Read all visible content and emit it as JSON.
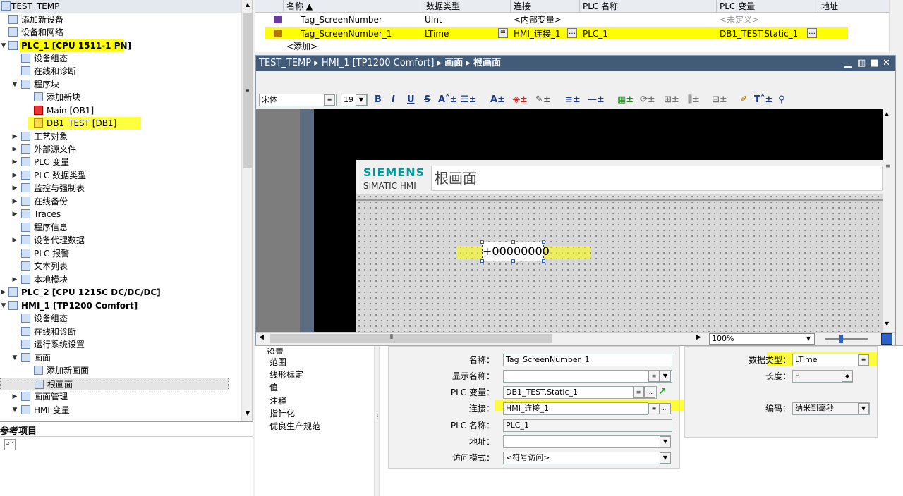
{
  "tree": {
    "project": "TEST_TEMP",
    "items": [
      {
        "label": "添加新设备",
        "level": 1
      },
      {
        "label": "设备和网络",
        "level": 1
      },
      {
        "label": "PLC_1 [CPU 1511-1 PN]",
        "level": 0
      },
      {
        "label": "设备组态",
        "level": 2
      },
      {
        "label": "在线和诊断",
        "level": 2
      },
      {
        "label": "程序块",
        "level": 2
      },
      {
        "label": "添加新块",
        "level": 3
      },
      {
        "label": "Main [OB1]",
        "level": 3
      },
      {
        "label": "DB1_TEST [DB1]",
        "level": 3
      },
      {
        "label": "工艺对象",
        "level": 2
      },
      {
        "label": "外部源文件",
        "level": 2
      },
      {
        "label": "PLC 变量",
        "level": 2
      },
      {
        "label": "PLC 数据类型",
        "level": 2
      },
      {
        "label": "监控与强制表",
        "level": 2
      },
      {
        "label": "在线备份",
        "level": 2
      },
      {
        "label": "Traces",
        "level": 2
      },
      {
        "label": "程序信息",
        "level": 2
      },
      {
        "label": "设备代理数据",
        "level": 2
      },
      {
        "label": "PLC 报警",
        "level": 2
      },
      {
        "label": "文本列表",
        "level": 2
      },
      {
        "label": "本地模块",
        "level": 2
      },
      {
        "label": "PLC_2 [CPU 1215C DC/DC/DC]",
        "level": 0
      },
      {
        "label": "HMI_1 [TP1200 Comfort]",
        "level": 0
      },
      {
        "label": "设备组态",
        "level": 2
      },
      {
        "label": "在线和诊断",
        "level": 2
      },
      {
        "label": "运行系统设置",
        "level": 2
      },
      {
        "label": "画面",
        "level": 2
      },
      {
        "label": "添加新画面",
        "level": 3
      },
      {
        "label": "根画面",
        "level": 3
      },
      {
        "label": "画面管理",
        "level": 2
      },
      {
        "label": "HMI 变量",
        "level": 2
      }
    ]
  },
  "reference": {
    "title": "参考项目"
  },
  "grid": {
    "headers": [
      "名称",
      "数据类型",
      "连接",
      "PLC 名称",
      "PLC 变量",
      "地址"
    ],
    "rows": [
      {
        "name": "Tag_ScreenNumber",
        "type": "UInt",
        "conn": "<内部变量>",
        "plc": "",
        "var": "<未定义>"
      },
      {
        "name": "Tag_ScreenNumber_1",
        "type": "LTime",
        "conn": "HMI_连接_1",
        "plc": "PLC_1",
        "var": "DB1_TEST.Static_1"
      }
    ],
    "add": "<添加>"
  },
  "editor": {
    "breadcrumb": [
      "TEST_TEMP",
      "HMI_1 [TP1200 Comfort]",
      "画面",
      "根画面"
    ],
    "font": "宋体",
    "size": "19",
    "brand": "SIEMENS",
    "product": "SIMATIC HMI",
    "screen_title": "根画面",
    "io_field": "+00000000",
    "zoom": "100%"
  },
  "props": {
    "nav": [
      "设置",
      "范围",
      "线形标定",
      "值",
      "注释",
      "指针化",
      "优良生产规范"
    ],
    "name_label": "名称：",
    "name_value": "Tag_ScreenNumber_1",
    "display_label": "显示名称：",
    "display_value": "",
    "plcvar_label": "PLC 变量：",
    "plcvar_value": "DB1_TEST.Static_1",
    "conn_label": "连接：",
    "conn_value": "HMI_连接_1",
    "plcname_label": "PLC 名称：",
    "plcname_value": "PLC_1",
    "addr_label": "地址：",
    "addr_value": "",
    "access_label": "访问模式：",
    "access_value": "<符号访问>",
    "dtype_label": "数据类型：",
    "dtype_value": "LTime",
    "len_label": "长度：",
    "len_value": "8",
    "enc_label": "编码：",
    "enc_value": "纳米到毫秒"
  }
}
